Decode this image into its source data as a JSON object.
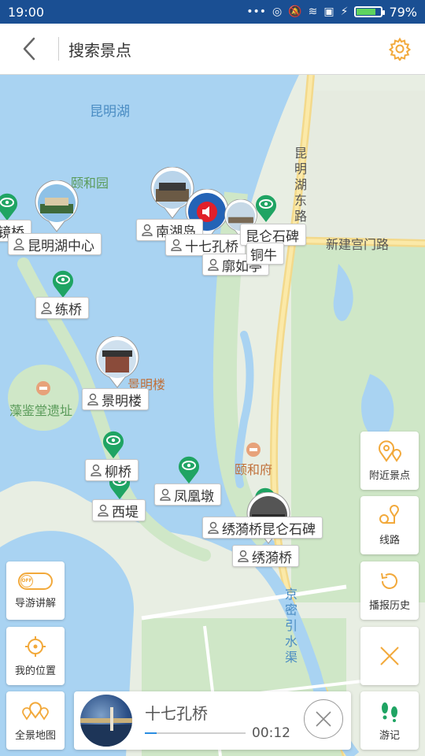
{
  "status_bar": {
    "time": "19:00",
    "icons_text": "•••",
    "battery_percent_label": "79%",
    "battery_level": 0.79
  },
  "header": {
    "title": "搜索景点",
    "back_icon": "chevron-left-icon",
    "settings_icon": "gear-icon"
  },
  "map": {
    "area_labels": {
      "lake": "昆明湖",
      "park": "颐和园",
      "road_vertical": "昆明湖东路",
      "road_new": "新建宫门路",
      "poi_jingminglou": "景明楼",
      "poi_zaojiantang": "藻鉴堂遗址",
      "poi_yiheyuan_fu": "颐和府",
      "canal": "京密引水渠"
    },
    "spots": [
      {
        "label": "镜桥"
      },
      {
        "label": "昆明湖中心"
      },
      {
        "label": "南湖岛"
      },
      {
        "label": "十七孔桥"
      },
      {
        "label": "廓如亭"
      },
      {
        "label": "昆仑石碑"
      },
      {
        "label": "铜牛"
      },
      {
        "label": "练桥"
      },
      {
        "label": "景明楼"
      },
      {
        "label": "柳桥"
      },
      {
        "label": "西堤"
      },
      {
        "label": "凤凰墩"
      },
      {
        "label": "绣漪桥昆仑石碑"
      },
      {
        "label": "绣漪桥"
      }
    ]
  },
  "side_buttons": {
    "nearby": "附近景点",
    "route": "线路",
    "history": "播报历史",
    "guide": "导游讲解",
    "guide_toggle": "OFF",
    "my_location": "我的位置",
    "panorama": "全景地图",
    "travel_notes": "游记"
  },
  "player": {
    "title": "十七孔桥",
    "time": "00:12",
    "progress": 0.12
  },
  "colors": {
    "accent": "#f2a93b",
    "status_bar": "#1a4f93",
    "pin_green": "#1fa463",
    "water": "#a9d3f2",
    "audio_red": "#e0202a"
  }
}
